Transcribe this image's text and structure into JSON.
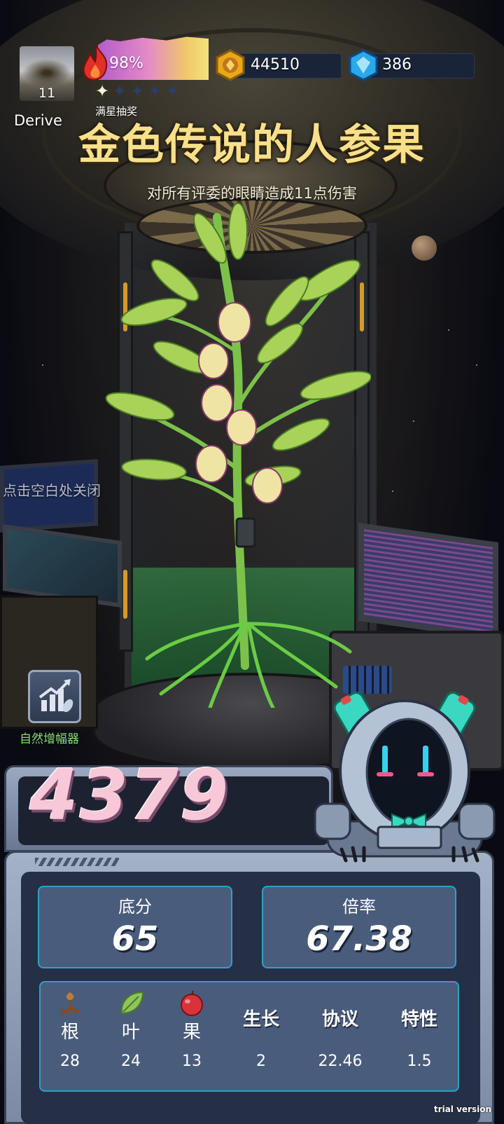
{
  "player": {
    "name": "Derive",
    "level": "11"
  },
  "energy": {
    "percent_label": "98%",
    "percent": 98
  },
  "stars": {
    "filled": 1,
    "total": 5,
    "caption": "满星抽奖"
  },
  "currency": {
    "gold": "44510",
    "gems": "386"
  },
  "item": {
    "title": "金色传说的人参果",
    "description": "对所有评委的眼睛造成11点伤害"
  },
  "close_hint": "点击空白处关闭",
  "amplifier": {
    "label": "自然增幅器",
    "icon": "growth-chart-icon"
  },
  "score": {
    "total": "4379",
    "base_label": "底分",
    "base_value": "65",
    "multiplier_label": "倍率",
    "multiplier_value": "67.38"
  },
  "attributes": [
    {
      "name": "根",
      "value": "28",
      "icon": "root-icon"
    },
    {
      "name": "叶",
      "value": "24",
      "icon": "leaf-icon"
    },
    {
      "name": "果",
      "value": "13",
      "icon": "apple-icon"
    },
    {
      "name": "生长",
      "value": "2"
    },
    {
      "name": "协议",
      "value": "22.46"
    },
    {
      "name": "特性",
      "value": "1.5"
    }
  ],
  "watermark": "trial version",
  "colors": {
    "title_gold": "#f8e08a",
    "panel_accent": "#2fa0c8",
    "score_pink": "#f6c8d8",
    "amp_green": "#8fe07a"
  }
}
